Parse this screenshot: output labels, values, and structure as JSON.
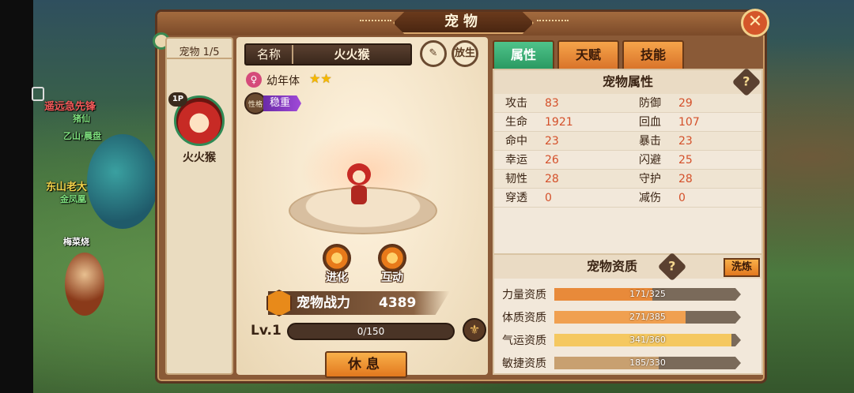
{
  "background": {
    "names": [
      {
        "text": "遥远急先锋",
        "color": "#f35a5a"
      },
      {
        "text": "猪仙",
        "color": "#7ee07e"
      },
      {
        "text": "乙山·晨盘",
        "color": "#7ee07e"
      },
      {
        "text": "东山老大",
        "color": "#f2d34a"
      },
      {
        "text": "金凤凰",
        "color": "#7ee07e"
      },
      {
        "text": "梅菜烧",
        "color": "#ffffff"
      }
    ]
  },
  "window": {
    "title": "宠物",
    "close_icon": "close-icon"
  },
  "pet_list": {
    "count_label": "宠物 1/5",
    "items": [
      {
        "badge": "1P",
        "name": "火火猴"
      }
    ]
  },
  "pet_detail": {
    "name_label": "名称",
    "name_value": "火火猴",
    "rename_icon": "edit-icon",
    "release_label": "放生",
    "gender_icon": "female-icon",
    "stage": "幼年体",
    "stars": "★★",
    "trait_icon_label": "性格",
    "trait": "稳重",
    "evolve_label": "进化",
    "interact_label": "互动",
    "power_label": "宠物战力",
    "power_value": "4389",
    "level": "Lv.1",
    "exp": "0/150",
    "rest_label": "休息"
  },
  "tabs": [
    {
      "label": "属性",
      "active": true
    },
    {
      "label": "天赋",
      "active": false
    },
    {
      "label": "技能",
      "active": false
    }
  ],
  "attributes": {
    "title": "宠物属性",
    "help": "?",
    "rows": [
      [
        {
          "name": "攻击",
          "value": "83"
        },
        {
          "name": "防御",
          "value": "29"
        }
      ],
      [
        {
          "name": "生命",
          "value": "1921"
        },
        {
          "name": "回血",
          "value": "107"
        }
      ],
      [
        {
          "name": "命中",
          "value": "23"
        },
        {
          "name": "暴击",
          "value": "23"
        }
      ],
      [
        {
          "name": "幸运",
          "value": "26"
        },
        {
          "name": "闪避",
          "value": "25"
        }
      ],
      [
        {
          "name": "韧性",
          "value": "28"
        },
        {
          "name": "守护",
          "value": "28"
        }
      ],
      [
        {
          "name": "穿透",
          "value": "0"
        },
        {
          "name": "减伤",
          "value": "0"
        }
      ]
    ]
  },
  "aptitude": {
    "title": "宠物资质",
    "help": "?",
    "wash_label": "洗炼",
    "rows": [
      {
        "name": "力量资质",
        "text": "171/325",
        "current": 171,
        "max": 325,
        "color": "#e88a3a"
      },
      {
        "name": "体质资质",
        "text": "271/385",
        "current": 271,
        "max": 385,
        "color": "#f0a050"
      },
      {
        "name": "气运资质",
        "text": "341/360",
        "current": 341,
        "max": 360,
        "color": "#f5c860"
      },
      {
        "name": "敏捷资质",
        "text": "185/330",
        "current": 185,
        "max": 330,
        "color": "#c8a070"
      }
    ]
  }
}
